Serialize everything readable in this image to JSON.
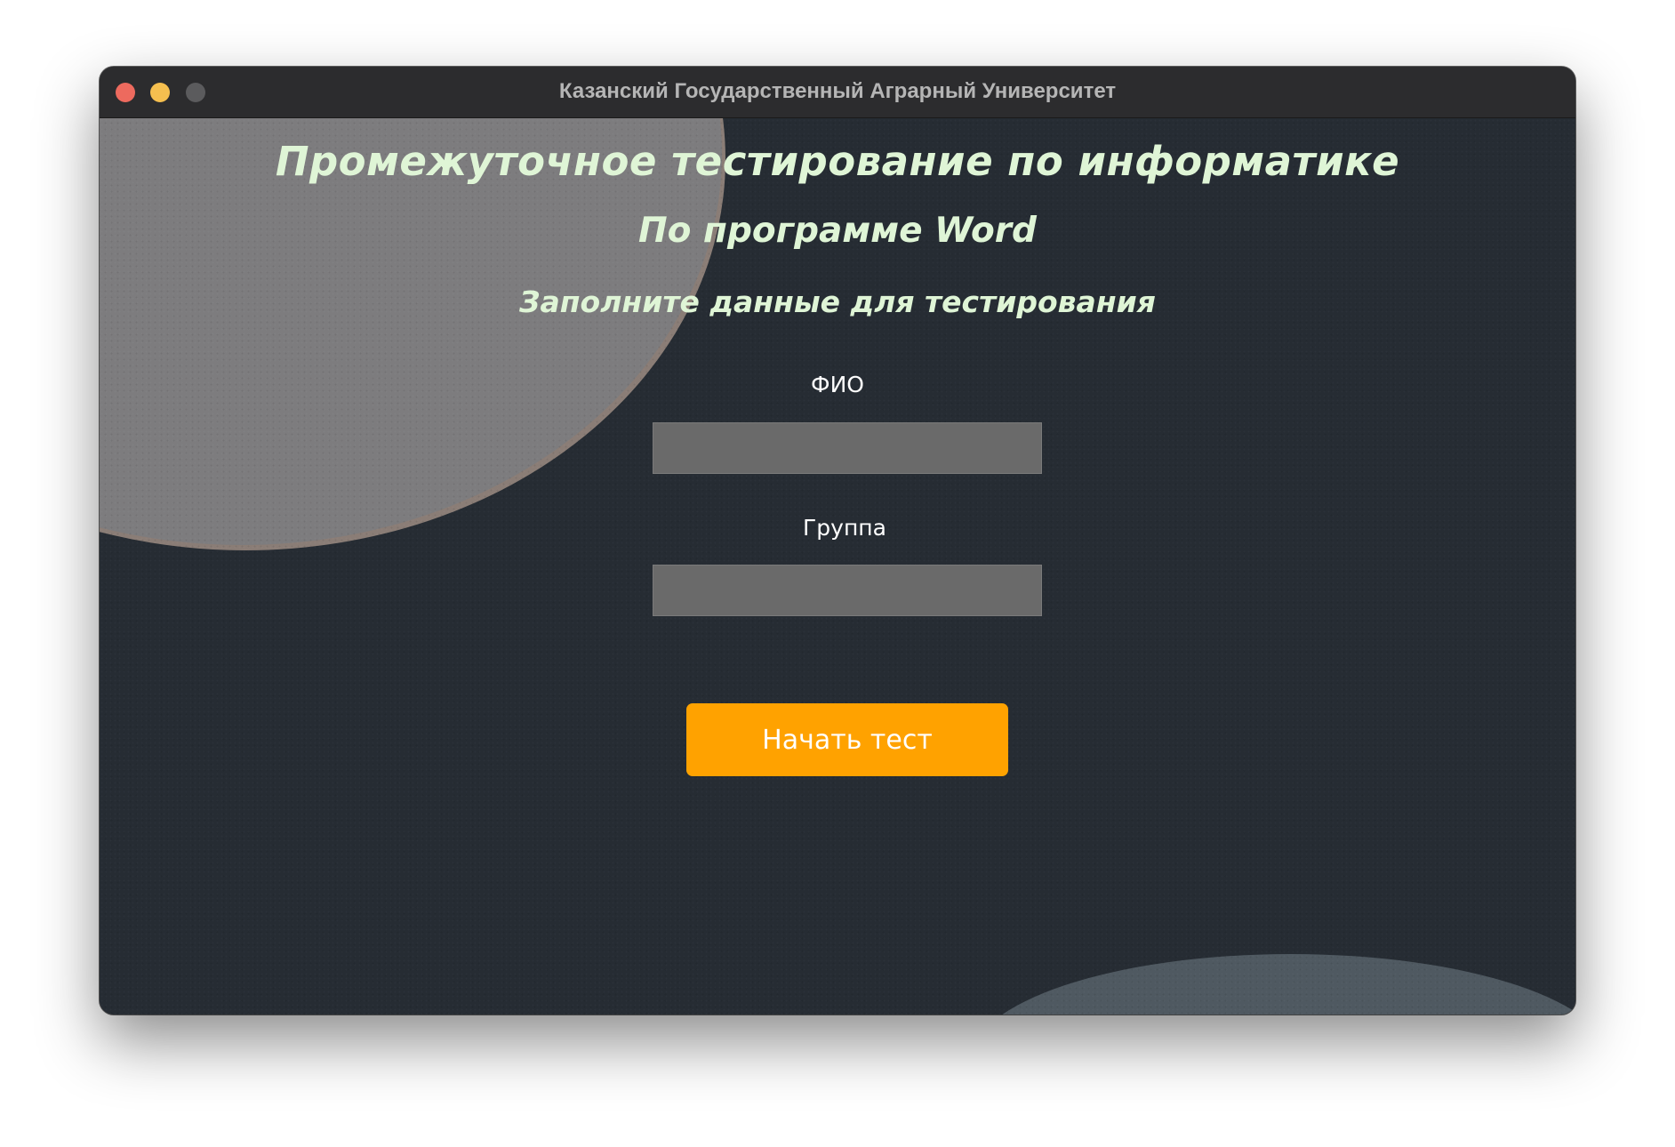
{
  "window": {
    "title": "Казанский Государственный Аграрный Университет"
  },
  "form": {
    "heading": "Промежуточное тестирование по информатике",
    "subheading": "По программе Word",
    "instruction": "Заполните данные для тестирования",
    "fio_label": "ФИО",
    "fio_value": "",
    "group_label": "Группа",
    "group_value": "",
    "start_button_label": "Начать тест"
  },
  "colors": {
    "heading_text": "#dff5d6",
    "button_bg": "#ffa200",
    "input_bg": "#6a6a6a",
    "background": "#262c33"
  }
}
